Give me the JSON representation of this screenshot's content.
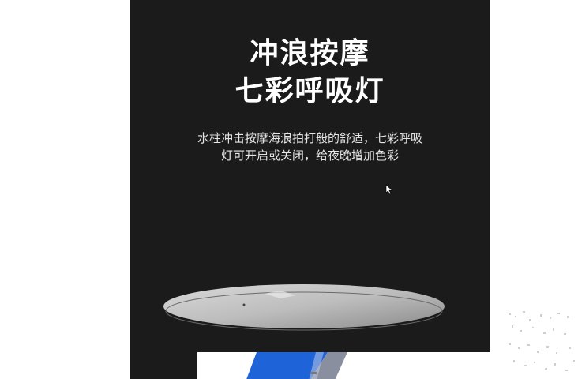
{
  "hero": {
    "title_line1": "冲浪按摩",
    "title_line2": "七彩呼吸灯",
    "desc_line1": "水柱冲击按摩海浪拍打般的舒适，七彩呼吸",
    "desc_line2": "灯可开启或关闭，给夜晚增加色彩"
  },
  "colors": {
    "panel_bg": "#1b1b1b",
    "title": "#ffffff",
    "desc": "#e6e6e6",
    "accent_blue": "#1e63d8"
  },
  "icons": {
    "cursor": "mouse-pointer-icon"
  }
}
